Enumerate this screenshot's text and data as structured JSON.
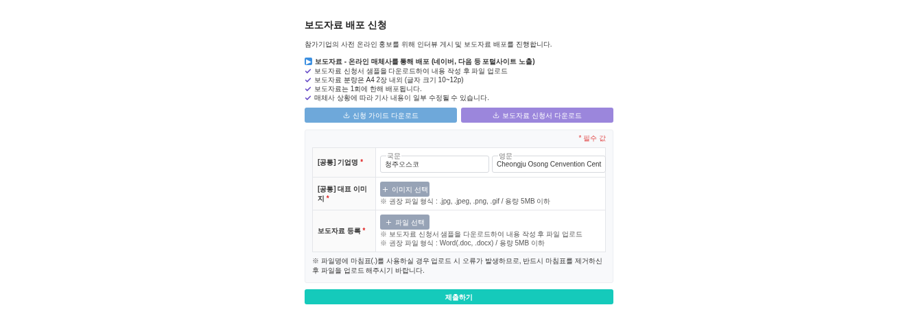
{
  "title": "보도자료 배포 신청",
  "intro": "참가기업의 사전 온라인 홍보를 위해 인터뷰 게시 및 보도자료 배포를 진행합니다.",
  "notice": {
    "icon": "▶",
    "heading": "보도자료",
    "subheading": "- 온라인 매체사를 통해 배포 (네이버, 다음 등 포털사이트 노출)",
    "items": [
      "보도자료 신청서 샘플을 다운로드하여 내용 작성 후 파일 업로드",
      "보도자료 분량은 A4 2장 내외 (글자 크기 10~12p)",
      "보도자료는 1회에 한해 배포됩니다.",
      "매체사 상황에 따라 기사 내용이 일부 수정될 수 있습니다."
    ]
  },
  "downloads": [
    {
      "label": "신청 가이드 다운로드",
      "color": "#6ea8da"
    },
    {
      "label": "보도자료 신청서 다운로드",
      "color": "#9b86dc"
    }
  ],
  "form": {
    "required_note": "* 필수 값",
    "rows": [
      {
        "kind": "text",
        "label": "[공통] 기업명",
        "mark": "*",
        "fields": [
          {
            "legend": "국문",
            "value": "청주오스코"
          },
          {
            "legend": "영문",
            "value": "Cheongju Osong Cenvention Cent"
          }
        ]
      },
      {
        "kind": "upload",
        "label": "[공통] 대표 이미지",
        "mark": "*",
        "button": "이미지 선택",
        "notes": [
          "※ 권장 파일 형식 : .jpg, .jpeg, .png, .gif / 용량 5MB 이하"
        ]
      },
      {
        "kind": "upload",
        "label": "보도자료 등록",
        "mark": "*",
        "button": "파일 선택",
        "notes": [
          "※ 보도자료 신청서 샘플을 다운로드하여 내용 작성 후 파일 업로드",
          "※ 권장 파일 형식 : Word(.doc, .docx) / 용량 5MB 이하"
        ]
      }
    ],
    "footnote": "※ 파일명에 마침표(.)를 사용하실 경우 업로드 시 오류가 발생하므로, 반드시 마침표를 제거하신 후 파일을 업로드 해주시기 바랍니다."
  },
  "submit": "제출하기"
}
